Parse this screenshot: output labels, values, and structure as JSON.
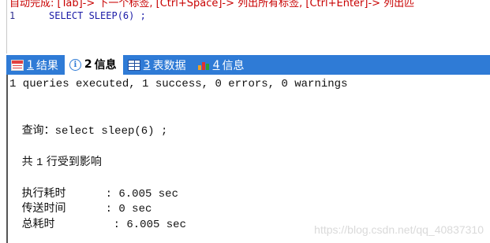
{
  "editor": {
    "hint": "自动完成: [Tab]-> 下一个标签, [Ctrl+Space]-> 列出所有标签, [Ctrl+Enter]-> 列出匹",
    "line_number": "1",
    "query": "SELECT SLEEP(6) ;"
  },
  "tabs": [
    {
      "number": "1",
      "label": "结果",
      "icon": "result-grid-icon"
    },
    {
      "number": "2",
      "label": "信息",
      "icon": "info-circle-icon"
    },
    {
      "number": "3",
      "label": "表数据",
      "icon": "table-data-icon"
    },
    {
      "number": "4",
      "label": "信息",
      "icon": "bar-chart-icon"
    }
  ],
  "output": {
    "summary": "1 queries executed, 1 success, 0 errors, 0 warnings",
    "query_label": "查询：",
    "query_text": "select sleep(6) ;",
    "affected_prefix": "共 ",
    "affected_count": "1",
    "affected_suffix": " 行受到影响",
    "exec_label": "执行耗时",
    "exec_value": ": 6.005 sec",
    "transfer_label": "传送时间",
    "transfer_value": ": 0 sec",
    "total_label": "总耗时",
    "total_value": ": 6.005 sec"
  },
  "watermark": "https://blog.csdn.net/qq_40837310"
}
